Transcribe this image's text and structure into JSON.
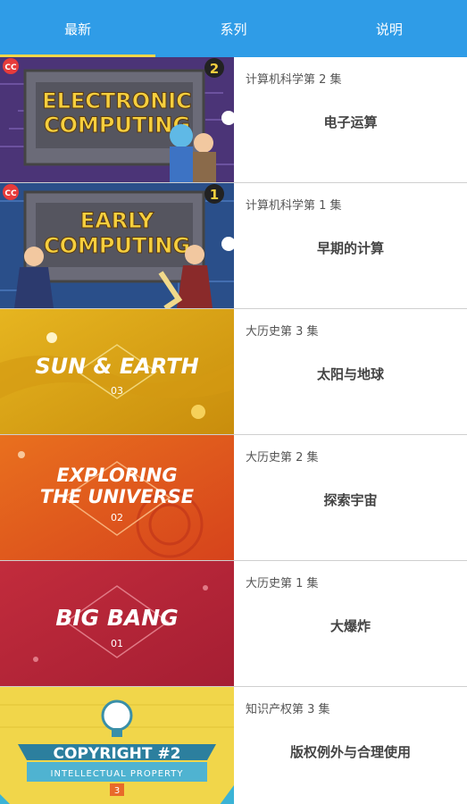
{
  "tabs": [
    {
      "label": "最新"
    },
    {
      "label": "系列"
    },
    {
      "label": "说明"
    }
  ],
  "items": [
    {
      "series": "计算机科学第 2 集",
      "title": "电子运算",
      "thumb": {
        "line1": "ELECTRONIC",
        "line2": "COMPUTING",
        "badge": "2",
        "cc": "CC",
        "bg": "#4b3477"
      }
    },
    {
      "series": "计算机科学第 1 集",
      "title": "早期的计算",
      "thumb": {
        "line1": "EARLY",
        "line2": "COMPUTING",
        "badge": "1",
        "cc": "CC",
        "bg": "#2a4f8a"
      }
    },
    {
      "series": "大历史第 3 集",
      "title": "太阳与地球",
      "thumb": {
        "line1": "SUN & EARTH",
        "num": "03",
        "bg": "#d9a514"
      }
    },
    {
      "series": "大历史第 2 集",
      "title": "探索宇宙",
      "thumb": {
        "line1": "EXPLORING",
        "line2": "THE UNIVERSE",
        "num": "02",
        "bg": "#e2581c"
      }
    },
    {
      "series": "大历史第 1 集",
      "title": "大爆炸",
      "thumb": {
        "line1": "BIG BANG",
        "num": "01",
        "bg": "#b8263a"
      }
    },
    {
      "series": "知识产权第 3 集",
      "title": "版权例外与合理使用",
      "thumb": {
        "line1": "COPYRIGHT #2",
        "line2": "INTELLECTUAL PROPERTY",
        "badge": "3",
        "bg": "#f1d64a"
      }
    }
  ]
}
